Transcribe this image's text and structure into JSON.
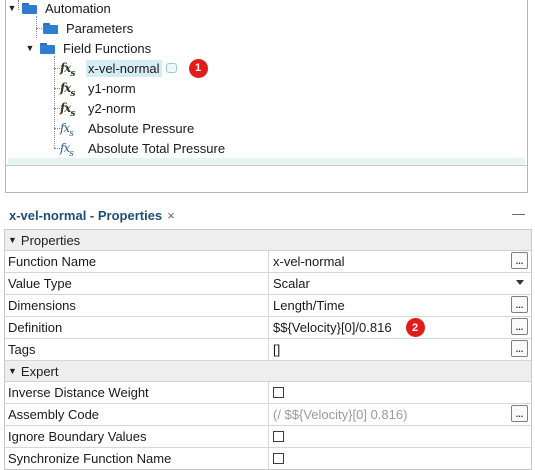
{
  "tree": {
    "items": [
      {
        "label": "Automation",
        "icon": "folder-icon"
      },
      {
        "label": "Parameters",
        "icon": "folder-icon"
      },
      {
        "label": "Field Functions",
        "icon": "folder-icon"
      },
      {
        "label": "x-vel-normal",
        "icon": "user-field-function-icon"
      },
      {
        "label": "y1-norm",
        "icon": "user-field-function-icon"
      },
      {
        "label": "y2-norm",
        "icon": "user-field-function-icon"
      },
      {
        "label": "Absolute Pressure",
        "icon": "field-function-icon"
      },
      {
        "label": "Absolute Total Pressure",
        "icon": "field-function-icon"
      }
    ],
    "callout": "1"
  },
  "properties_panel": {
    "title": "x-vel-normal - Properties",
    "close_glyph": "×",
    "minimize_glyph": "—",
    "sections": {
      "properties": "Properties",
      "expert": "Expert"
    },
    "rows": {
      "function_name": {
        "name": "Function Name",
        "value": "x-vel-normal"
      },
      "value_type": {
        "name": "Value Type",
        "value": "Scalar"
      },
      "dimensions": {
        "name": "Dimensions",
        "value": "Length/Time"
      },
      "definition": {
        "name": "Definition",
        "value": "$${Velocity}[0]/0.816"
      },
      "tags": {
        "name": "Tags",
        "value": "[]"
      },
      "inverse_distance_weight": {
        "name": "Inverse Distance Weight",
        "checked": false
      },
      "assembly_code": {
        "name": "Assembly Code",
        "value": "(/ $${Velocity}[0] 0.816)"
      },
      "ignore_boundary_values": {
        "name": "Ignore Boundary Values",
        "checked": false
      },
      "synchronize_function_name": {
        "name": "Synchronize Function Name",
        "checked": false
      }
    },
    "ellipsis_label": "...",
    "callout": "2"
  },
  "colors": {
    "accent_title": "#1e4f7a",
    "selection": "#d6ecf5",
    "callout": "#e41b1b",
    "folder": "#2f7dd1"
  }
}
